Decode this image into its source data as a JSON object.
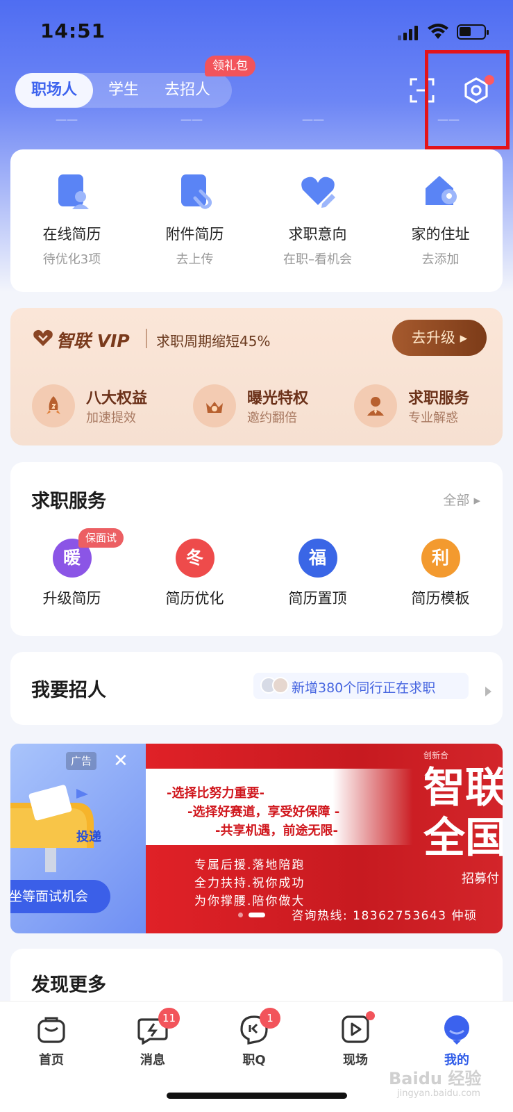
{
  "status_bar": {
    "time": "14:51"
  },
  "header": {
    "tabs": [
      {
        "label": "职场人",
        "active": true
      },
      {
        "label": "学生",
        "active": false
      },
      {
        "label": "去招人",
        "active": false
      }
    ],
    "gift_badge": "领礼包"
  },
  "resume_shortcuts": [
    {
      "title": "在线简历",
      "sub": "待优化3项",
      "icon": "document-user-icon"
    },
    {
      "title": "附件简历",
      "sub": "去上传",
      "icon": "attachment-icon"
    },
    {
      "title": "求职意向",
      "sub": "在职–看机会",
      "icon": "heart-edit-icon"
    },
    {
      "title": "家的住址",
      "sub": "去添加",
      "icon": "home-location-icon"
    }
  ],
  "vip": {
    "brand": "智联 VIP",
    "slogan": "求职周期缩短45%",
    "upgrade_label": "去升级 ▸",
    "benefits": [
      {
        "title": "八大权益",
        "sub": "加速提效",
        "icon": "rocket-icon"
      },
      {
        "title": "曝光特权",
        "sub": "邀约翻倍",
        "icon": "eye-crown-icon"
      },
      {
        "title": "求职服务",
        "sub": "专业解惑",
        "icon": "advisor-icon"
      }
    ]
  },
  "services": {
    "title": "求职服务",
    "more_label": "全部 ▸",
    "badge": "保面试",
    "items": [
      {
        "glyph": "暖",
        "label": "升级简历",
        "color": "#8b55e6"
      },
      {
        "glyph": "冬",
        "label": "简历优化",
        "color": "#ee4b4b"
      },
      {
        "glyph": "福",
        "label": "简历置顶",
        "color": "#3a66e6"
      },
      {
        "glyph": "利",
        "label": "简历模板",
        "color": "#f39a2f"
      }
    ]
  },
  "hire": {
    "title": "我要招人",
    "tip": "新增380个同行正在求职"
  },
  "banner": {
    "ad_tag": "广告",
    "close": "✕",
    "cta": "坐等面试机会",
    "mailbox_label": "投递",
    "lines": [
      "-选择比努力重要-",
      "-选择好赛道，享受好保障 -",
      "-共享机遇，前途无限-"
    ],
    "small_lines": [
      "专属后援.落地陪跑",
      "全力扶持.祝你成功",
      "为你撑腰.陪你做大"
    ],
    "big_text": [
      "智联",
      "全国"
    ],
    "tiny_text": "创新合",
    "recruit_text": "招募付",
    "hotline": "咨询热线: 18362753643 仲硕"
  },
  "discover": {
    "title": "发现更多"
  },
  "bottom_nav": [
    {
      "label": "首页",
      "icon": "bag-icon",
      "badge": "",
      "active": false
    },
    {
      "label": "消息",
      "icon": "message-icon",
      "badge": "11",
      "active": false
    },
    {
      "label": "职Q",
      "icon": "chat-q-icon",
      "badge": "1",
      "active": false
    },
    {
      "label": "现场",
      "icon": "video-icon",
      "badge": "",
      "dot": true,
      "active": false
    },
    {
      "label": "我的",
      "icon": "profile-icon",
      "badge": "",
      "active": true
    }
  ],
  "watermark": {
    "main": "Baidu 经验",
    "sub": "jingyan.baidu.com"
  },
  "colors": {
    "accent": "#3d63ee",
    "highlight_box": "#e3141a",
    "badge_red": "#f2545b",
    "vip_brown": "#7a3a1c"
  }
}
